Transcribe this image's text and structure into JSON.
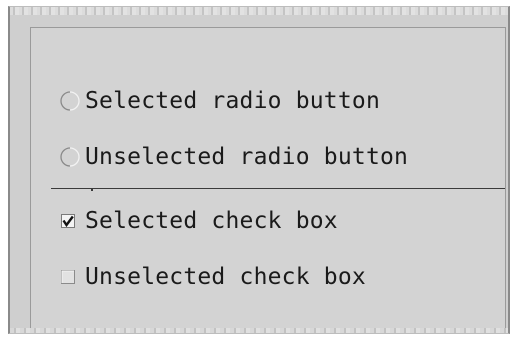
{
  "options": {
    "radio_selected_label": "Selected radio button",
    "radio_unselected_label": "Unselected radio button",
    "checkbox_selected_label": "Selected check box",
    "checkbox_unselected_label": "Unselected check box",
    "radio_selected_checked": true,
    "radio_unselected_checked": false,
    "checkbox_selected_checked": true,
    "checkbox_unselected_checked": false
  },
  "colors": {
    "window_bg": "#cfcfcf",
    "panel_bg": "#d3d3d3",
    "text": "#1a1a1a",
    "separator": "#3a3a3a"
  },
  "icons": {
    "radio": "radio-circle-icon",
    "checkbox_checked": "checkmark-box-icon",
    "checkbox_unchecked": "empty-box-icon"
  }
}
